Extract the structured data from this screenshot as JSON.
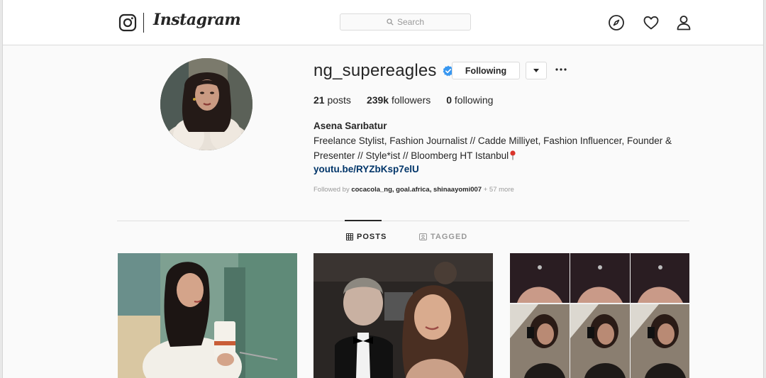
{
  "app": {
    "wordmark": "Instagram",
    "search_placeholder": "Search",
    "nav_icons": [
      "compass-icon",
      "heart-icon",
      "person-icon"
    ]
  },
  "profile": {
    "username": "ng_supereagles",
    "verified": true,
    "following_button": "Following",
    "stats": {
      "posts_count": "21",
      "posts_label": "posts",
      "followers_count": "239k",
      "followers_label": "followers",
      "following_count": "0",
      "following_label": "following"
    },
    "full_name": "Asena Sarıbatur",
    "bio_line1": "Freelance Stylist, Fashion Journalist // Cadde Milliyet, Fashion Influencer, Founder &",
    "bio_line2": "Presenter // Style*ist // Bloomberg HT Istanbul",
    "bio_emoji": "pin",
    "link": "youtu.be/RYZbKsp7elU",
    "followed_by_prefix": "Followed by",
    "followed_by_names": "cocacola_ng, goal.africa, shinaayomi007",
    "followed_by_more": "+ 57 more"
  },
  "tabs": [
    {
      "label": "POSTS",
      "active": true
    },
    {
      "label": "TAGGED",
      "active": false
    }
  ],
  "colors": {
    "verified_blue": "#3897f0",
    "link_blue": "#003569",
    "border": "#dbdbdb"
  }
}
